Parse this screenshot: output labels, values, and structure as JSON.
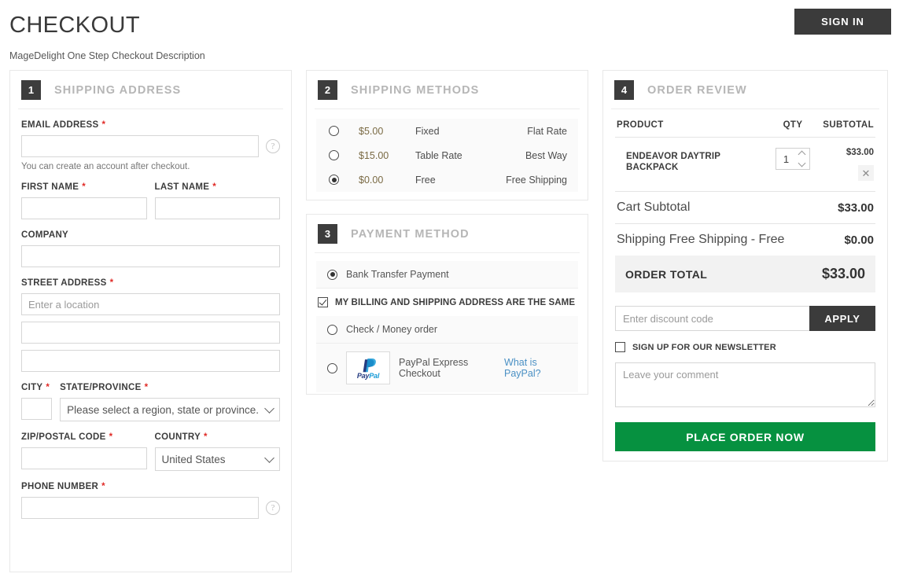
{
  "header": {
    "title": "CHECKOUT",
    "description": "MageDelight One Step Checkout Description",
    "signin_label": "SIGN IN"
  },
  "shipping_address": {
    "step": "1",
    "title": "SHIPPING ADDRESS",
    "email_label": "EMAIL ADDRESS",
    "email_value": "",
    "email_hint": "You can create an account after checkout.",
    "first_name_label": "FIRST NAME",
    "first_name_value": "",
    "last_name_label": "LAST NAME",
    "last_name_value": "",
    "company_label": "COMPANY",
    "company_value": "",
    "street_label": "STREET ADDRESS",
    "street1_placeholder": "Enter a location",
    "street1_value": "",
    "street2_value": "",
    "street3_value": "",
    "city_label": "CITY",
    "city_value": "",
    "state_label": "STATE/PROVINCE",
    "state_value": "Please select a region, state or province.",
    "zip_label": "ZIP/POSTAL CODE",
    "zip_value": "",
    "country_label": "COUNTRY",
    "country_value": "United States",
    "phone_label": "PHONE NUMBER",
    "phone_value": "",
    "required_marker": "*",
    "help_glyph": "?"
  },
  "shipping_methods": {
    "step": "2",
    "title": "SHIPPING METHODS",
    "options": [
      {
        "price": "$5.00",
        "method": "Fixed",
        "carrier": "Flat Rate",
        "selected": false
      },
      {
        "price": "$15.00",
        "method": "Table Rate",
        "carrier": "Best Way",
        "selected": false
      },
      {
        "price": "$0.00",
        "method": "Free",
        "carrier": "Free Shipping",
        "selected": true
      }
    ]
  },
  "payment_method": {
    "step": "3",
    "title": "PAYMENT METHOD",
    "bank_transfer_label": "Bank Transfer Payment",
    "bank_transfer_selected": true,
    "billing_same_label": "MY BILLING AND SHIPPING ADDRESS ARE THE SAME",
    "billing_same_checked": true,
    "check_money_label": "Check / Money order",
    "check_money_selected": false,
    "paypal_label": "PayPal Express Checkout",
    "paypal_link": "What is PayPal?",
    "paypal_logo_text": "PayPal",
    "paypal_selected": false
  },
  "order_review": {
    "step": "4",
    "title": "ORDER REVIEW",
    "columns": {
      "product": "PRODUCT",
      "qty": "QTY",
      "subtotal": "SUBTOTAL"
    },
    "items": [
      {
        "name": "ENDEAVOR DAYTRIP BACKPACK",
        "qty": "1",
        "subtotal": "$33.00",
        "remove_glyph": "✕"
      }
    ],
    "totals": [
      {
        "label": "Cart Subtotal",
        "value": "$33.00"
      },
      {
        "label": "Shipping Free Shipping - Free",
        "value": "$0.00"
      }
    ],
    "grand_total_label": "ORDER TOTAL",
    "grand_total_value": "$33.00",
    "discount_placeholder": "Enter discount code",
    "discount_value": "",
    "apply_label": "APPLY",
    "newsletter_label": "SIGN UP FOR OUR NEWSLETTER",
    "newsletter_checked": false,
    "comment_placeholder": "Leave your comment",
    "comment_value": "",
    "place_order_label": "PLACE ORDER NOW"
  },
  "colors": {
    "step_badge": "#3d3d3d",
    "panel_title": "#b6b6b6",
    "required": "#e02b27",
    "place_order": "#069140",
    "apply": "#3b3b3b",
    "link": "#4a90c4"
  }
}
